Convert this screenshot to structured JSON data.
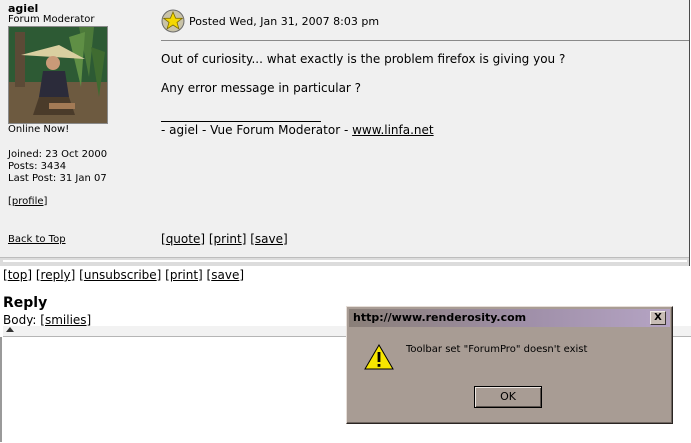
{
  "post": {
    "author": {
      "username": "agiel",
      "role": "Forum Moderator",
      "status": "Online Now!",
      "joined": "Joined: 23 Oct 2000",
      "posts": "Posts: 3434",
      "last_post": "Last Post: 31 Jan 07",
      "profile_link": "profile"
    },
    "back_to_top": "Back to Top",
    "posted": "Posted Wed, Jan 31, 2007 8:03 pm",
    "message_lines": [
      "Out of curiosity... what exactly is the problem firefox is giving you ?",
      "Any error message in particular ?"
    ],
    "signature_text": "- agiel - Vue Forum Moderator - ",
    "signature_link": "www.linfa.net",
    "actions": [
      "quote",
      "print",
      "save"
    ]
  },
  "thread_actions": [
    "top",
    "reply",
    "unsubscribe",
    "print",
    "save"
  ],
  "reply": {
    "title": "Reply",
    "body_label": "Body:",
    "smilies_link": "smilies"
  },
  "dialog": {
    "title": "http://www.renderosity.com",
    "message": "Toolbar set \"ForumPro\" doesn't exist",
    "ok_label": "OK",
    "close_label": "X",
    "icon": "warning-icon"
  },
  "colors": {
    "post_bg": "#f0f0f0",
    "dialog_bg": "#a89c94",
    "dialog_title_gradient_end": "#b5a4c4"
  }
}
